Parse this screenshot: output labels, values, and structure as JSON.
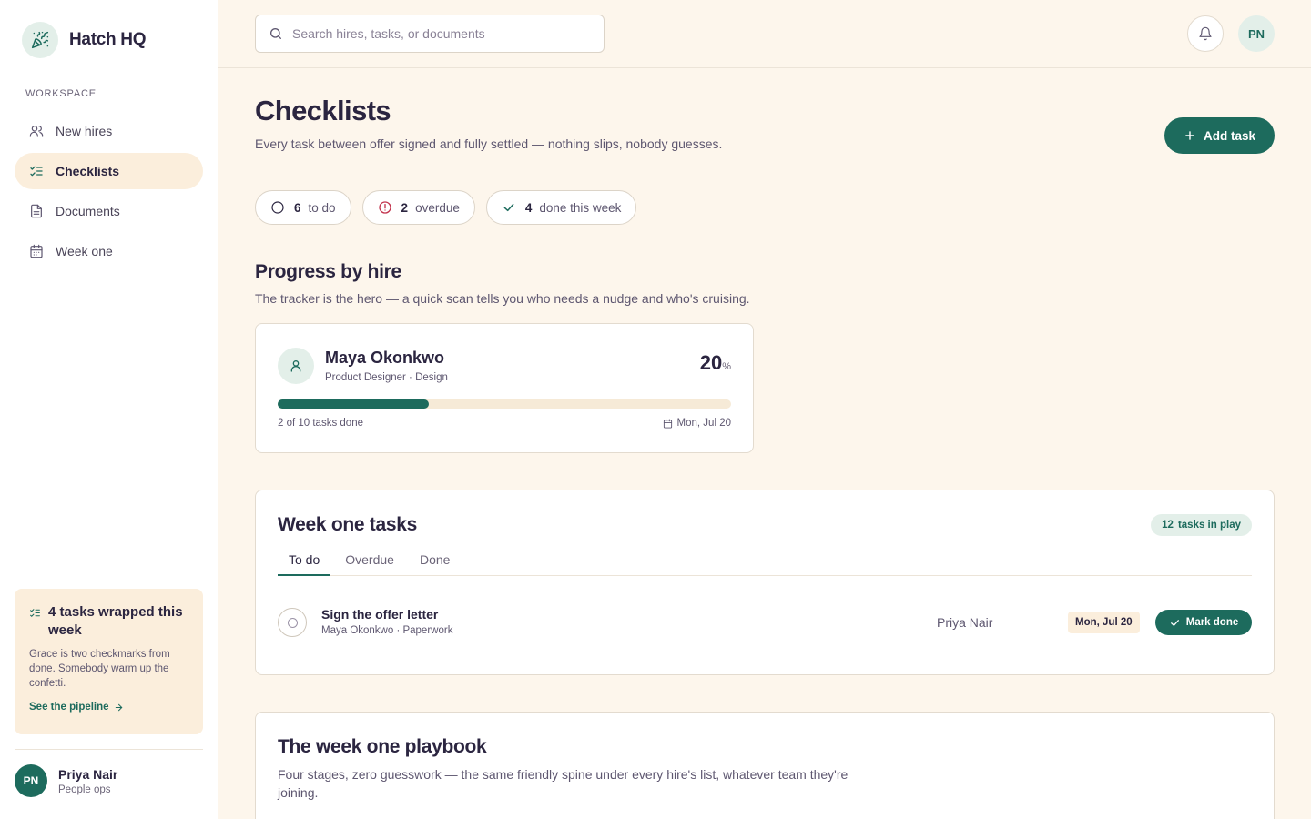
{
  "brand": {
    "name": "Hatch HQ",
    "icon": "party-popper-icon"
  },
  "sidebar": {
    "section_label": "WORKSPACE",
    "items": [
      {
        "label": "New hires",
        "icon": "users-icon",
        "active": false
      },
      {
        "label": "Checklists",
        "icon": "list-checks-icon",
        "active": true
      },
      {
        "label": "Documents",
        "icon": "document-icon",
        "active": false
      },
      {
        "label": "Week one",
        "icon": "calendar-icon",
        "active": false
      }
    ],
    "promo": {
      "title": "4 tasks wrapped this week",
      "body": "Grace is two checkmarks from done. Somebody warm up the confetti.",
      "link": "See the pipeline"
    },
    "user": {
      "initials": "PN",
      "name": "Priya Nair",
      "role": "People ops"
    }
  },
  "topbar": {
    "search_placeholder": "Search hires, tasks, or documents",
    "avatar_initials": "PN"
  },
  "page": {
    "title": "Checklists",
    "subtitle": "Every task between offer signed and fully settled — nothing slips, nobody guesses.",
    "add_button": "Add task"
  },
  "stats": [
    {
      "count": "6",
      "label": "to do",
      "icon": "circle-icon"
    },
    {
      "count": "2",
      "label": "overdue",
      "icon": "alert-circle-icon"
    },
    {
      "count": "4",
      "label": "done this week",
      "icon": "check-icon"
    }
  ],
  "progress": {
    "title": "Progress by hire",
    "subtitle": "The tracker is the hero — a quick scan tells you who needs a nudge and who's cruising.",
    "hire": {
      "name": "Maya Okonkwo",
      "role": "Product Designer · Design",
      "percent": "20",
      "percent_unit": "%",
      "progress_fraction": 0.2,
      "tasks_done": "2 of 10 tasks done",
      "date": "Mon, Jul 20"
    }
  },
  "tasks": {
    "title": "Week one tasks",
    "in_play_count": "12",
    "in_play_label": "tasks in play",
    "tabs": [
      "To do",
      "Overdue",
      "Done"
    ],
    "active_tab": "To do",
    "rows": [
      {
        "name": "Sign the offer letter",
        "meta": "Maya Okonkwo · Paperwork",
        "owner": "Priya Nair",
        "due": "Mon, Jul 20",
        "action": "Mark done"
      }
    ]
  },
  "playbook": {
    "title": "The week one playbook",
    "subtitle": "Four stages, zero guesswork — the same friendly spine under every hire's list, whatever team they're joining."
  },
  "colors": {
    "accent": "#1d6b5d",
    "background": "#fdf6ec",
    "highlight": "#fbeedc",
    "danger": "#c2334d"
  }
}
